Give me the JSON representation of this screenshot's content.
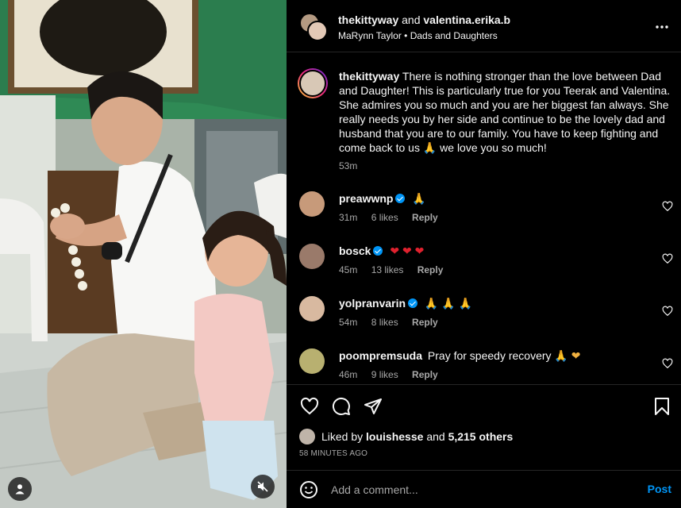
{
  "header": {
    "user1": "thekittyway",
    "conjunction": "and",
    "user2": "valentina.erika.b",
    "artist": "MaRynn Taylor",
    "separator": "•",
    "song": "Dads and Daughters",
    "more_icon": "more-horizontal-icon"
  },
  "caption": {
    "user": "thekittyway",
    "text": "There is nothing stronger than the love between Dad and Daughter! This is particularly true for you Teerak and Valentina. She admires you so much and you are her biggest fan always. She really needs you by her side and continue to be the lovely dad and husband that you are to our family. You have to keep fighting and come back to us",
    "emoji": "🙏",
    "text_end": "we love you so much!",
    "time": "53m"
  },
  "comments": [
    {
      "user": "preawwnp",
      "verified": true,
      "text": "🙏",
      "time": "31m",
      "likes": "6 likes",
      "reply": "Reply"
    },
    {
      "user": "bosck",
      "verified": true,
      "text": "❤ ❤ ❤",
      "time": "45m",
      "likes": "13 likes",
      "reply": "Reply"
    },
    {
      "user": "yolpranvarin",
      "verified": true,
      "text": "🙏 🙏 🙏",
      "time": "54m",
      "likes": "8 likes",
      "reply": "Reply"
    },
    {
      "user": "poompremsuda",
      "verified": false,
      "text": "Pray for speedy recovery",
      "emoji": "🙏 ❤",
      "time": "46m",
      "likes": "9 likes",
      "reply": "Reply"
    }
  ],
  "actions": {
    "like_icon": "heart-icon",
    "comment_icon": "comment-icon",
    "share_icon": "send-icon",
    "save_icon": "bookmark-icon"
  },
  "likes": {
    "prefix": "Liked by",
    "user": "louishesse",
    "and": "and",
    "count": "5,215 others"
  },
  "posted": "58 MINUTES AGO",
  "add_comment": {
    "placeholder": "Add a comment...",
    "post_label": "Post"
  },
  "colors": {
    "accent": "#0095f6",
    "secondary_text": "#a8a8a8",
    "divider": "#262626",
    "heart_red": "#e0212e"
  }
}
